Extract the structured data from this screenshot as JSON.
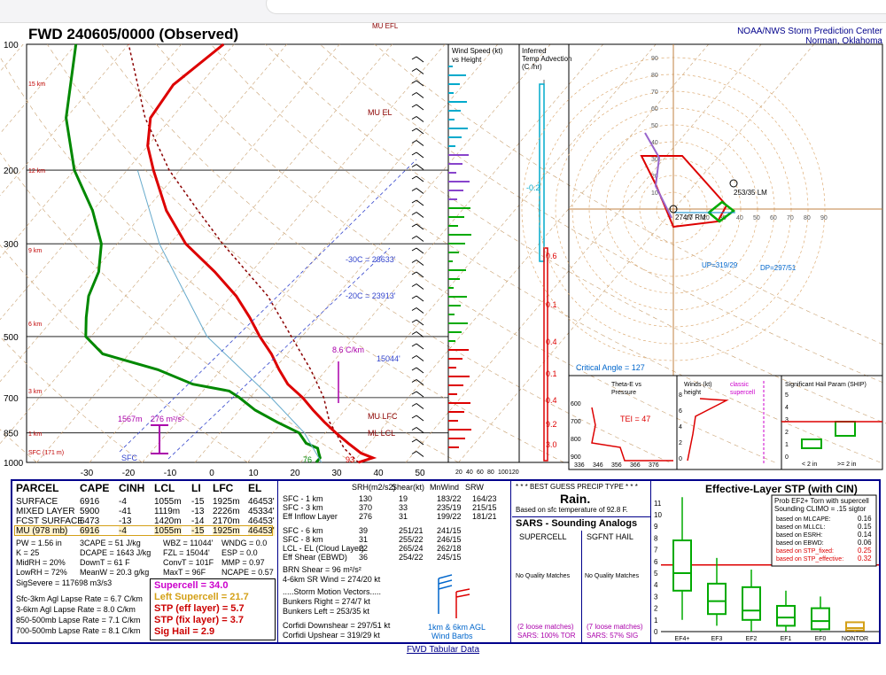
{
  "header": {
    "title": "FWD   240605/0000  (Observed)",
    "center_line1": "NOAA/NWS Storm Prediction Center",
    "center_line2": "Norman, Oklahoma"
  },
  "skewt": {
    "pressure_labels": [
      "100",
      "200",
      "300",
      "500",
      "700",
      "850",
      "1000"
    ],
    "pressure_levels": [
      100,
      200,
      300,
      500,
      700,
      850,
      1000
    ],
    "temp_labels": [
      "-30",
      "-20",
      "-10",
      "0",
      "10",
      "20",
      "30",
      "40",
      "50"
    ],
    "height_labels": [
      "15 km",
      "12 km",
      "9 km",
      "6 km",
      "3 km",
      "1 km",
      "SFC (171 m)"
    ],
    "annotations": {
      "mu_el": "MU  EL",
      "mu_lfc": "MU  LFC",
      "mu_lcl": "ML  LCL",
      "c30": "-30C = 28633'",
      "c20": "-20C = 23913'",
      "lapse": "8.6 C/km",
      "lapse_hgt": "15044'",
      "sfc": "SFC",
      "km1567": "1567m",
      "cape276": "276 m²/s²",
      "t93": "93",
      "t76": "76",
      "mu_top": "MU  EFL"
    }
  },
  "wind_panel": {
    "title": "Wind Speed (kt)",
    "sub": "vs Height",
    "ticks": [
      "20",
      "40",
      "60",
      "80",
      "100",
      "120"
    ]
  },
  "temp_adv": {
    "title": "Inferred",
    "sub": "Temp Advection",
    "unit": "(C /hr)",
    "values": [
      "-0.2",
      "0.6",
      "0.1",
      "0.4",
      "0.1",
      "0.4",
      "9.2",
      "3.0"
    ]
  },
  "hodo": {
    "rings": [
      "10",
      "20",
      "30",
      "40",
      "50",
      "60",
      "70",
      "80",
      "90"
    ],
    "lm": "253/35 LM",
    "rm": "274/7 RM",
    "up": "UP=319/29",
    "dn": "DP=297/51",
    "critical": "Critical Angle = 127"
  },
  "theta": {
    "title": "Theta-E vs",
    "sub": "Pressure",
    "tei": "TEI = 47",
    "xlabels": [
      "336",
      "346",
      "356",
      "366",
      "376"
    ],
    "ylabels": [
      "600",
      "700",
      "800",
      "900"
    ]
  },
  "srw": {
    "title": "Winds (kt)",
    "sub": "height",
    "classic": "classic",
    "supercell": "supercell",
    "ylabels": [
      "8",
      "6",
      "4",
      "2",
      "0"
    ]
  },
  "ship": {
    "title": "Significant Hail Param (SHIP)",
    "ylabels": [
      "5",
      "4",
      "3",
      "2",
      "1",
      "0"
    ],
    "xl1": "< 2 in",
    "xl2": ">= 2 in"
  },
  "parcel": {
    "headers": [
      "PARCEL",
      "CAPE",
      "CINH",
      "LCL",
      "LI",
      "LFC",
      "EL"
    ],
    "rows": [
      [
        "SURFACE",
        "6916",
        "-4",
        "1055m",
        "-15",
        "1925m",
        "46453'"
      ],
      [
        "MIXED LAYER",
        "5900",
        "-41",
        "1119m",
        "-13",
        "2226m",
        "45334'"
      ],
      [
        "FCST SURFACE",
        "6473",
        "-13",
        "1420m",
        "-14",
        "2170m",
        "46453'"
      ],
      [
        "MU  (978 mb)",
        "6916",
        "-4",
        "1055m",
        "-15",
        "1925m",
        "46453'"
      ]
    ],
    "extra": [
      [
        "PW = 1.56  in",
        "3CAPE = 51 J/kg",
        "WBZ = 11044'",
        "WNDG = 0.0"
      ],
      [
        "K = 25",
        "DCAPE = 1643 J/kg",
        "FZL = 15044'",
        "ESP = 0.0"
      ],
      [
        "MidRH = 20%",
        "DownT = 61  F",
        "ConvT = 101F",
        "MMP = 0.97"
      ],
      [
        "LowRH = 72%",
        "MeanW = 20.3 g/kg",
        "MaxT = 96F",
        "NCAPE = 0.57"
      ]
    ],
    "sigsevere": "SigSevere = 117698 m3/s3",
    "lapse": [
      "Sfc-3km Agl Lapse Rate = 6.7 C/km",
      "3-6km Agl Lapse Rate = 8.0 C/km",
      "850-500mb Lapse Rate = 7.1 C/km",
      "700-500mb Lapse Rate = 8.1 C/km"
    ],
    "composites": [
      {
        "label": "Supercell = 34.0",
        "color": "#cc00cc"
      },
      {
        "label": "Left Supercell = 21.7",
        "color": "#d4a017"
      },
      {
        "label": "STP (eff layer) = 5.7",
        "color": "#cc0000"
      },
      {
        "label": "STP (fix layer) = 3.7",
        "color": "#cc0000"
      },
      {
        "label": "Sig Hail = 2.9",
        "color": "#cc0000"
      }
    ]
  },
  "shear": {
    "headers": [
      "SRH(m2/s2)",
      "Shear(kt)",
      "MnWind",
      "SRW"
    ],
    "rows": [
      [
        "SFC - 1 km",
        "130",
        "19",
        "183/22",
        "164/23"
      ],
      [
        "SFC - 3 km",
        "370",
        "33",
        "235/19",
        "215/15"
      ],
      [
        "Eff Inflow Layer",
        "276",
        "31",
        "199/22",
        "181/21"
      ],
      [
        "SFC - 6 km",
        "39",
        "251/21",
        "241/15",
        ""
      ],
      [
        "SFC - 8 km",
        "31",
        "255/22",
        "246/15",
        ""
      ],
      [
        "LCL - EL (Cloud Layer)",
        "22",
        "265/24",
        "262/18",
        ""
      ],
      [
        "Eff Shear (EBWD)",
        "36",
        "254/22",
        "245/15",
        ""
      ]
    ],
    "brn": "BRN Shear =  96 m²/s²",
    "mw4": "4-6km SR Wind =       274/20 kt",
    "smv": ".....Storm Motion Vectors.....",
    "br": "Bunkers Right =        274/7 kt",
    "bl": "Bunkers Left =        253/35 kt",
    "cd": "Corfidi Downshear =  297/51 kt",
    "cu": "Corfidi Upshear =    319/29 kt",
    "barbs": "1km & 6km AGL",
    "barbs2": "Wind Barbs"
  },
  "precip": {
    "title": "* * * BEST GUESS PRECIP TYPE * * *",
    "type": "Rain.",
    "note": "Based on sfc temperature of 92.8 F."
  },
  "analogs": {
    "title": "SARS - Sounding Analogs",
    "col1": "SUPERCELL",
    "col2": "SGFNT HAIL",
    "nm1": "No Quality Matches",
    "nm2": "No Quality Matches",
    "lm1": "(2 loose matches)",
    "lm2": "(7 loose matches)",
    "p1": "SARS:  100% TOR",
    "p2": "SARS:  57% SIG"
  },
  "stp": {
    "title": "Effective-Layer STP (with CIN)",
    "legend_title": "Prob EF2+ Torn with supercell",
    "legend_sub": "Sounding CLIMO = .15 sigtor",
    "legend": [
      [
        "based on MLCAPE:",
        "0.16"
      ],
      [
        "based on MLLCL:",
        "0.15"
      ],
      [
        "based on ESRH:",
        "0.14"
      ],
      [
        "based on EBWD:",
        "0.06"
      ],
      [
        "based on STP_fixed:",
        "0.25"
      ],
      [
        "based on STP_effective:",
        "0.32"
      ]
    ],
    "ylabels": [
      "11",
      "10",
      "9",
      "8",
      "7",
      "6",
      "5",
      "4",
      "3",
      "2",
      "1",
      "0"
    ],
    "cats": [
      "EF4+",
      "EF3",
      "EF2",
      "EF1",
      "EF0",
      "NONTOR"
    ]
  },
  "chart_data": {
    "type": "line",
    "title": "FWD   240605/0000  (Observed)",
    "xlabel": "",
    "ylabel": "",
    "pressure_axis_mb": [
      100,
      200,
      300,
      500,
      700,
      850,
      1000
    ],
    "temperature_axis_C": [
      -30,
      -20,
      -10,
      0,
      10,
      20,
      30,
      40,
      50
    ],
    "series": [
      {
        "name": "",
        "points": [
          [
            1000,
            32
          ],
          [
            925,
            27
          ],
          [
            850,
            23
          ],
          [
            700,
            10
          ],
          [
            500,
            -8
          ],
          [
            300,
            -36
          ],
          [
            200,
            -55
          ],
          [
            100,
            -63
          ]
        ]
      },
      {
        "name": "",
        "points": [
          [
            1000,
            23
          ],
          [
            925,
            21
          ],
          [
            850,
            14
          ],
          [
            700,
            -4
          ],
          [
            500,
            -40
          ],
          [
            300,
            -50
          ],
          [
            200,
            -68
          ],
          [
            100,
            -86
          ]
        ]
      }
    ],
    "stp_boxes": [
      {
        "cat": "EF4+",
        "min": 1,
        "q1": 3.5,
        "med": 5,
        "q3": 7.8,
        "max": 11.5
      },
      {
        "cat": "EF3",
        "min": 0.5,
        "q1": 1.5,
        "med": 2.6,
        "q3": 4.1,
        "max": 6.3
      },
      {
        "cat": "EF2",
        "min": 0,
        "q1": 1,
        "med": 1.8,
        "q3": 3.8,
        "max": 5.3
      },
      {
        "cat": "EF1",
        "min": 0,
        "q1": 0.5,
        "med": 1.2,
        "q3": 2.2,
        "max": 3.5
      },
      {
        "cat": "EF0",
        "min": 0,
        "q1": 0.2,
        "med": 0.9,
        "q3": 2,
        "max": 3
      },
      {
        "cat": "NONTOR",
        "min": 0,
        "q1": 0.1,
        "med": 0.3,
        "q3": 0.8,
        "max": 0.8
      }
    ]
  }
}
